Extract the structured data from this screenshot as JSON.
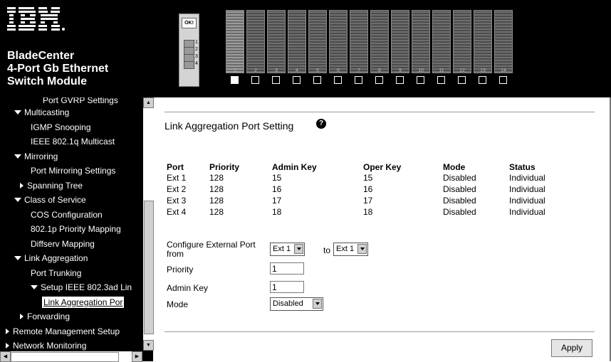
{
  "header": {
    "logo_text": "IBM.",
    "brand_lines": [
      "BladeCenter",
      "4-Port Gb Ethernet",
      "Switch Module"
    ],
    "switch_led": "OK!",
    "ext_ports": [
      "1",
      "2",
      "3",
      "4"
    ],
    "blade_numbers": [
      "1",
      "2",
      "3",
      "4",
      "5",
      "6",
      "7",
      "8",
      "9",
      "10",
      "11",
      "12",
      "13",
      "14"
    ],
    "selected_blade": "1"
  },
  "nav": {
    "items": [
      {
        "label": "Port GVRP Settings",
        "icon": "none"
      },
      {
        "label": "Multicasting",
        "icon": "expanded-arrow-icon"
      },
      {
        "label": "IGMP Snooping",
        "icon": "none"
      },
      {
        "label": "IEEE 802.1q Multicast",
        "icon": "none"
      },
      {
        "label": "Mirroring",
        "icon": "expanded-arrow-icon"
      },
      {
        "label": "Port Mirroring Settings",
        "icon": "none"
      },
      {
        "label": "Spanning Tree",
        "icon": "collapsed-arrow-icon"
      },
      {
        "label": "Class of Service",
        "icon": "expanded-arrow-icon"
      },
      {
        "label": "COS Configuration",
        "icon": "none"
      },
      {
        "label": "802.1p Priority Mapping",
        "icon": "none"
      },
      {
        "label": "Diffserv Mapping",
        "icon": "none"
      },
      {
        "label": "Link Aggregation",
        "icon": "expanded-arrow-icon"
      },
      {
        "label": "Port Trunking",
        "icon": "none"
      },
      {
        "label": "Setup IEEE 802.3ad Lin",
        "icon": "expanded-arrow-icon"
      },
      {
        "label": "Link Aggregation Por",
        "icon": "none"
      },
      {
        "label": "Forwarding",
        "icon": "collapsed-arrow-icon"
      },
      {
        "label": "Remote Management Setup",
        "icon": "collapsed-arrow-icon"
      },
      {
        "label": "Network Monitoring",
        "icon": "collapsed-arrow-icon"
      }
    ]
  },
  "main": {
    "title": "Link Aggregation Port Setting",
    "help_icon": "help-icon",
    "table": {
      "headers": [
        "Port",
        "Priority",
        "Admin Key",
        "Oper Key",
        "Mode",
        "Status"
      ],
      "rows": [
        [
          "Ext 1",
          "128",
          "15",
          "15",
          "Disabled",
          "Individual"
        ],
        [
          "Ext 2",
          "128",
          "16",
          "16",
          "Disabled",
          "Individual"
        ],
        [
          "Ext 3",
          "128",
          "17",
          "17",
          "Disabled",
          "Individual"
        ],
        [
          "Ext 4",
          "128",
          "18",
          "18",
          "Disabled",
          "Individual"
        ]
      ]
    },
    "form": {
      "configure_label_line1": "Configure External Port",
      "configure_label_line2": "from",
      "from_value": "Ext 1",
      "to_label": "to",
      "to_value": "Ext 1",
      "priority_label": "Priority",
      "priority_value": "1",
      "admin_key_label": "Admin Key",
      "admin_key_value": "1",
      "mode_label": "Mode",
      "mode_value": "Disabled"
    },
    "apply_label": "Apply"
  }
}
